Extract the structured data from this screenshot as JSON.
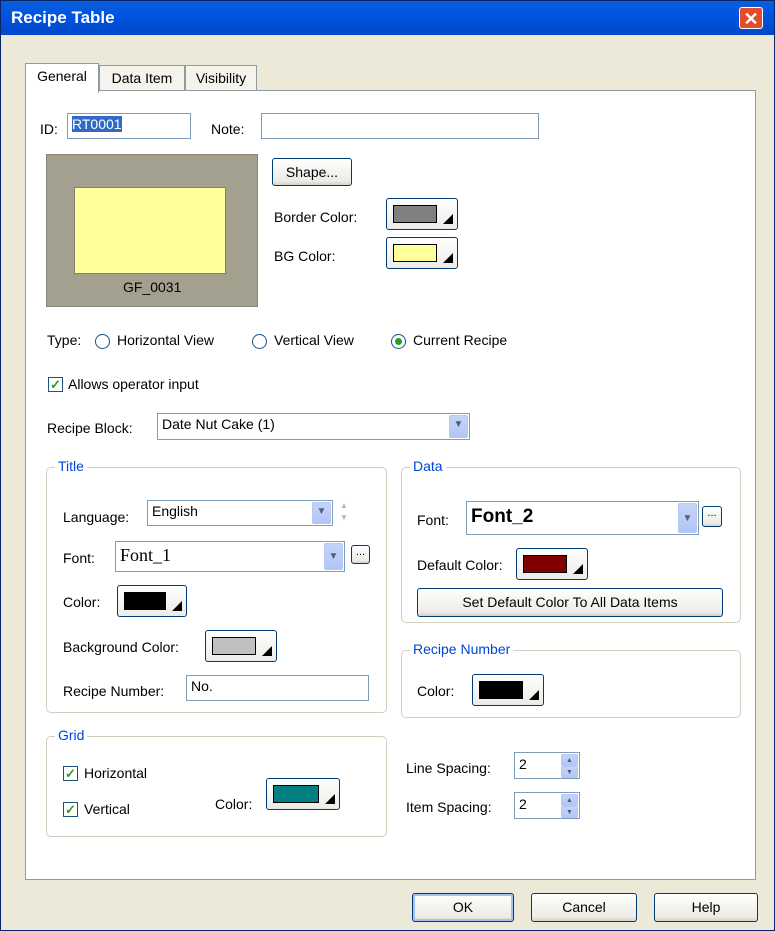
{
  "window": {
    "title": "Recipe Table",
    "close_label": "✕"
  },
  "tabs": [
    {
      "label": "General",
      "active": true
    },
    {
      "label": "Data Item",
      "active": false
    },
    {
      "label": "Visibility",
      "active": false
    }
  ],
  "general": {
    "id_label": "ID:",
    "id_value": "RT0001",
    "note_label": "Note:",
    "note_value": "",
    "preview_caption": "GF_0031",
    "shape_button": "Shape...",
    "border_color_label": "Border Color:",
    "border_color": "#808080",
    "bg_color_label": "BG Color:",
    "bg_color": "#ffff99",
    "type_label": "Type:",
    "type_options": [
      "Horizontal View",
      "Vertical View",
      "Current Recipe"
    ],
    "type_selected": "Current Recipe",
    "allows_input_label": "Allows operator input",
    "allows_input_checked": true,
    "recipe_block_label": "Recipe Block:",
    "recipe_block_value": "Date Nut Cake (1)"
  },
  "title_group": {
    "label": "Title",
    "language_label": "Language:",
    "language_value": "English",
    "font_label": "Font:",
    "font_value": "Font_1",
    "font_more": "...",
    "color_label": "Color:",
    "color": "#000000",
    "bg_color_label": "Background Color:",
    "bg_color": "#c0c0c0",
    "recipe_number_label": "Recipe Number:",
    "recipe_number_value": "No."
  },
  "data_group": {
    "label": "Data",
    "font_label": "Font:",
    "font_value": "Font_2",
    "font_more": "...",
    "default_color_label": "Default Color:",
    "default_color": "#800000",
    "set_default_button": "Set Default Color To All Data Items"
  },
  "recipe_number_group": {
    "label": "Recipe Number",
    "color_label": "Color:",
    "color": "#000000"
  },
  "grid_group": {
    "label": "Grid",
    "horizontal_label": "Horizontal",
    "horizontal_checked": true,
    "vertical_label": "Vertical",
    "vertical_checked": true,
    "color_label": "Color:",
    "color": "#008080"
  },
  "spacing": {
    "line_spacing_label": "Line Spacing:",
    "line_spacing_value": "2",
    "item_spacing_label": "Item Spacing:",
    "item_spacing_value": "2"
  },
  "footer": {
    "ok": "OK",
    "cancel": "Cancel",
    "help": "Help"
  }
}
